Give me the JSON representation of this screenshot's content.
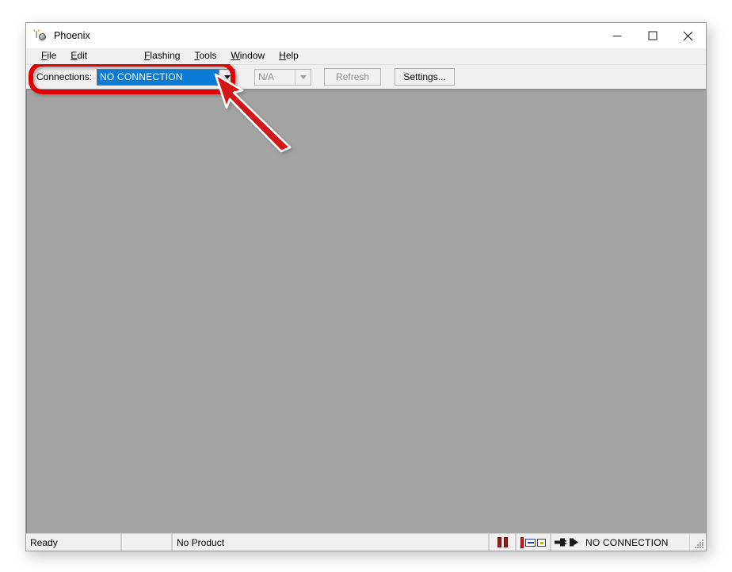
{
  "window": {
    "title": "Phoenix",
    "icon": "phoenix-app-icon",
    "controls": {
      "minimize": "minimize-icon",
      "maximize": "maximize-icon",
      "close": "close-icon"
    }
  },
  "menu": {
    "items": [
      {
        "label": "File",
        "accel": "F"
      },
      {
        "label": "Edit",
        "accel": "E"
      },
      {
        "label": "Flashing",
        "accel": "F"
      },
      {
        "label": "Tools",
        "accel": "T"
      },
      {
        "label": "Window",
        "accel": "W"
      },
      {
        "label": "Help",
        "accel": "H"
      }
    ]
  },
  "toolbar": {
    "connections_label": "Connections:",
    "connections_value": "NO CONNECTION",
    "connections_options": [
      "NO CONNECTION"
    ],
    "na_value": "N/A",
    "refresh_label": "Refresh",
    "settings_label": "Settings...",
    "refresh_enabled": false,
    "na_enabled": false
  },
  "status_bar": {
    "ready_text": "Ready",
    "blank_text": "",
    "product_text": "No Product",
    "pause_icon": "pause-icon",
    "mode_icon": "mode-indicator-icon",
    "plug_icon": "disconnected-plug-icon",
    "connection_text": "NO CONNECTION",
    "grip": "resize-grip-icon"
  },
  "annotation": {
    "highlight_shape": "rounded-rectangle",
    "highlight_color": "#e00000",
    "arrow_color": "#d41212",
    "arrow_target": "connections-dropdown-arrow"
  },
  "colors": {
    "selection_blue": "#0a7ad4",
    "client_gray": "#a3a3a3",
    "chrome_gray": "#f0f0f0",
    "annotation_red": "#e00000"
  }
}
